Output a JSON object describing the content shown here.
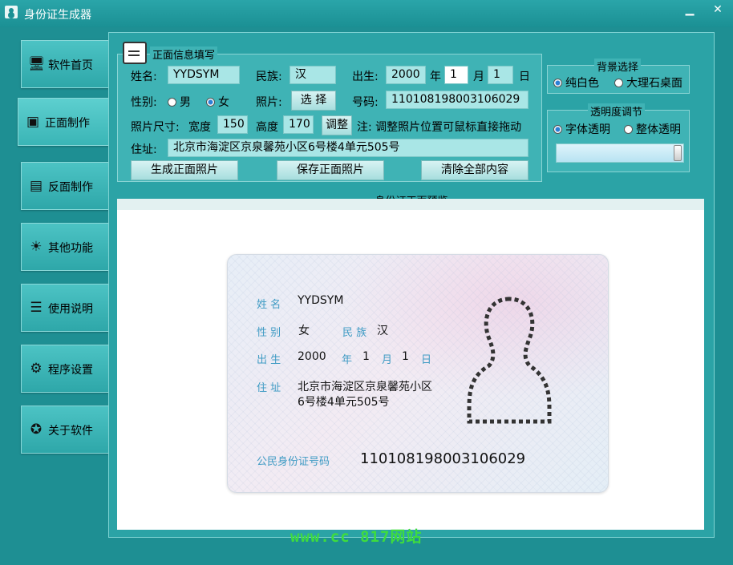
{
  "window": {
    "title": "身份证生成器",
    "minimize": "▁",
    "close": "✕"
  },
  "sidebar": {
    "items": [
      {
        "label": "软件首页",
        "icon": "monitor-icon",
        "glyph": "🖥"
      },
      {
        "label": "正面制作",
        "icon": "id-card-icon",
        "glyph": "🪪"
      },
      {
        "label": "反面制作",
        "icon": "id-card-back-icon",
        "glyph": "▤"
      },
      {
        "label": "其他功能",
        "icon": "sun-icon",
        "glyph": "☀"
      },
      {
        "label": "使用说明",
        "icon": "list-icon",
        "glyph": "☰"
      },
      {
        "label": "程序设置",
        "icon": "gear-icon",
        "glyph": "⚙"
      },
      {
        "label": "关于软件",
        "icon": "star-circle-icon",
        "glyph": "✪"
      }
    ],
    "active": 1
  },
  "form": {
    "title": "正面信息填写",
    "name_label": "姓名:",
    "name_value": "YYDSYM",
    "ethnic_label": "民族:",
    "ethnic_value": "汉",
    "birth_label": "出生:",
    "birth_year": "2000",
    "year_unit": "年",
    "birth_month": "1",
    "month_unit": "月",
    "birth_day": "1",
    "day_unit": "日",
    "gender_label": "性别:",
    "gender_male": "男",
    "gender_female": "女",
    "photo_label": "照片:",
    "photo_button": "选 择",
    "number_label": "号码:",
    "number_value": "110108198003106029",
    "photo_size_label": "照片尺寸:",
    "width_label": "宽度",
    "width_value": "150",
    "height_label": "高度",
    "height_value": "170",
    "adjust_button": "调整",
    "note": "注: 调整照片位置可鼠标直接拖动",
    "address_label": "住址:",
    "address_value": "北京市海淀区京泉馨苑小区6号楼4单元505号",
    "generate_button": "生成正面照片",
    "save_button": "保存正面照片",
    "clear_button": "清除全部内容"
  },
  "background": {
    "title": "背景选择",
    "option_white": "纯白色",
    "option_marble": "大理石桌面"
  },
  "opacity": {
    "title": "透明度调节",
    "option_font": "字体透明",
    "option_all": "整体透明",
    "level": 1.0
  },
  "preview": {
    "title": "身份证正面预览",
    "name_key": "姓 名",
    "name": "YYDSYM",
    "gender_key": "性 别",
    "gender": "女",
    "ethnic_key": "民 族",
    "ethnic": "汉",
    "birth_key": "出 生",
    "year": "2000",
    "year_unit": "年",
    "month": "1",
    "month_unit": "月",
    "day": "1",
    "day_unit": "日",
    "address_key": "住 址",
    "address_line1": "北京市海淀区京泉馨苑小区",
    "address_line2": "6号楼4单元505号",
    "id_key": "公民身份证号码",
    "id_number": "110108198003106029"
  },
  "watermark": "www.cc 817网站",
  "colors": {
    "accent": "#2ba3a6",
    "label_blue": "#3f9bc4"
  }
}
